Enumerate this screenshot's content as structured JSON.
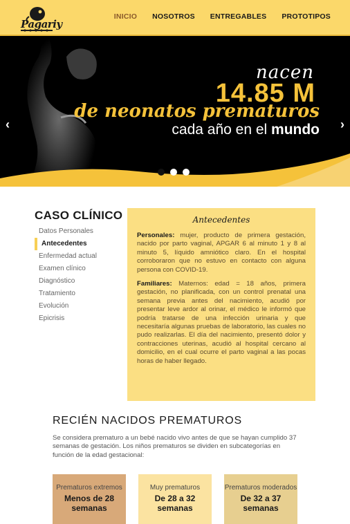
{
  "brand": {
    "logo_text": "Pagariy",
    "logo_icon": "bird-logo-icon"
  },
  "nav": {
    "items": [
      {
        "label": "INICIO",
        "active": true
      },
      {
        "label": "NOSOTROS",
        "active": false
      },
      {
        "label": "ENTREGABLES",
        "active": false
      },
      {
        "label": "PROTOTIPOS",
        "active": false
      }
    ]
  },
  "hero": {
    "line1": "nacen",
    "number": "14.85 M",
    "line3": "de neonatos prematuros",
    "line4_prefix": "cada año en el ",
    "line4_bold": "mundo",
    "prev_icon": "chevron-left-icon",
    "next_icon": "chevron-right-icon",
    "slides_total": 3,
    "slide_active": 1
  },
  "caso": {
    "title": "CASO CLÍNICO",
    "menu": [
      "Datos Personales",
      "Antecedentes",
      "Enfermedad actual",
      "Examen clínico",
      "Diagnóstico",
      "Tratamiento",
      "Evolución",
      "Epicrisis"
    ],
    "active_index": 1,
    "box_title": "Antecedentes",
    "personales_label": "Personales:",
    "personales_text": " mujer, producto de primera gestación, nacido por parto vaginal, APGAR 6 al minuto 1 y 8 al minuto 5, líquido amniótico claro. En el hospital corroboraron que no estuvo en contacto con alguna persona con COVID-19.",
    "familiares_label": "Familiares:",
    "familiares_text": " Maternos: edad = 18 años, primera gestación, no planificada, con un control prenatal una semana previa antes del nacimiento, acudió por presentar leve ardor al orinar, el médico le informó que podría tratarse de una infección urinaria y que necesitaría algunas pruebas de laboratorio, las cuales no pudo realizarlas. El día del nacimiento, presentó dolor y contracciones uterinas, acudió al hospital cercano al domicilio, en el cual ocurre el parto vaginal a las pocas horas de haber llegado."
  },
  "prematuros": {
    "title": "RECIÉN NACIDOS PREMATUROS",
    "text": "Se considera prematuro a un bebé nacido vivo antes de que se hayan cumplido 37 semanas de gestación. Los niños prematuros se dividen en subcategorías en función de la edad gestacional:",
    "cards": [
      {
        "title": "Prematuros extremos",
        "value": "Menos de 28 semanas"
      },
      {
        "title": "Muy prematuros",
        "value": "De 28 a 32 semanas"
      },
      {
        "title": "Prematuros moderados",
        "value": "De 32 a 37 semanas"
      }
    ]
  },
  "colors": {
    "header": "#fbd86a",
    "accent": "#f5c23a",
    "box": "#fbdf83",
    "card_extremos": "#d8a979",
    "card_muy": "#fbe3a1",
    "card_moderados": "#e7cf90"
  }
}
